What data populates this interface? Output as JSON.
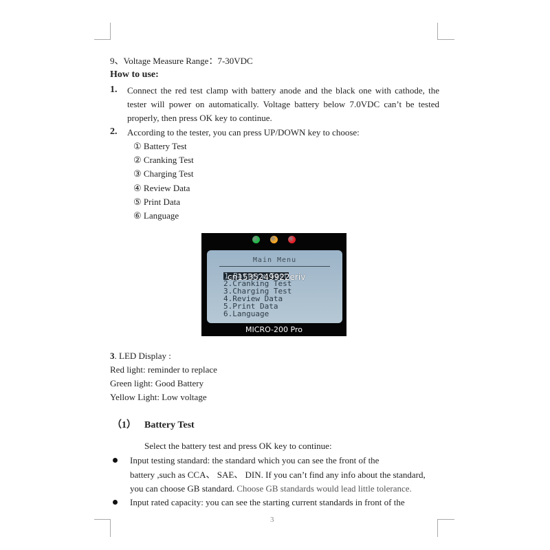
{
  "spec_line": "9、Voltage Measure Range：7-30VDC",
  "how_to_use": {
    "heading": "How to use:",
    "steps": [
      {
        "number": "1.",
        "lines": [
          "Connect the red test clamp with battery anode and the black one with cathode, the",
          "tester will power on automatically. Voltage battery below 7.0VDC can’t be tested",
          "properly, then press OK key to continue."
        ]
      },
      {
        "number": "2.",
        "lines": [
          "According to the tester, you can press UP/DOWN key to choose:"
        ]
      }
    ],
    "options": [
      {
        "marker": "①",
        "label": "Battery Test"
      },
      {
        "marker": "②",
        "label": "Cranking Test"
      },
      {
        "marker": "③",
        "label": "Charging Test"
      },
      {
        "marker": "④",
        "label": "Review Data"
      },
      {
        "marker": "⑤",
        "label": "Print Data"
      },
      {
        "marker": "⑥",
        "label": "Language"
      }
    ]
  },
  "device": {
    "leds": [
      {
        "name": "green",
        "color": "#22b84a"
      },
      {
        "name": "yellow",
        "color": "#f5a623"
      },
      {
        "name": "red",
        "color": "#e8202a"
      }
    ],
    "screen_title": "Main Menu",
    "menu": [
      "1.Battery Test",
      "2.Cranking Test",
      "3.Charging Test",
      "4.Review Data",
      "5.Print Data",
      "6.Language"
    ],
    "watermark": "cn1535249922eriv",
    "model": "MICRO-200 Pro"
  },
  "led_display": {
    "heading_num": "3",
    "heading": ". LED Display :",
    "lines": [
      "Red light: reminder to replace",
      "Green light: Good Battery",
      "Yellow Light: Low voltage"
    ]
  },
  "battery_test": {
    "section_num": "（1）",
    "title": "Battery Test",
    "intro": "Select the battery test and press OK key to continue:",
    "bullets": [
      {
        "lines": [
          "Input testing standard: the standard which you can see the front of the",
          "battery ,such as CCA、 SAE、 DIN. If you can’t find any info about the standard,",
          "you can choose GB standard."
        ],
        "note": " Choose GB standards would lead little tolerance."
      },
      {
        "lines": [
          "Input rated capacity: you can see the starting current standards in front of the"
        ]
      }
    ]
  },
  "page_number": "3"
}
